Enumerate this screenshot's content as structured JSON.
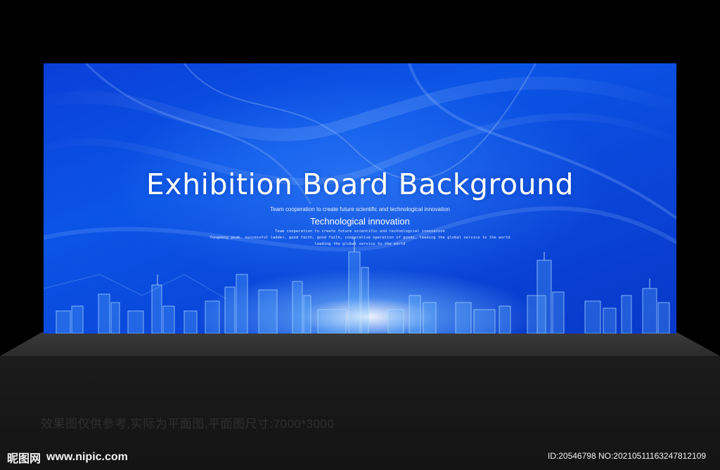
{
  "board": {
    "title": "Exhibition Board Background",
    "line1": "Team cooperation to create future scientific and technological innovation",
    "line2": "Technological innovation",
    "line3": "Team cooperation to create future scientific and technological innovation",
    "line4": "Yongdeng peak, successful ladder, good faith, good faith, cooperative operation of goods, leading the global service to the world",
    "line5": "leading the global service to the world"
  },
  "caption": "效果图仅供参考,实际为平面图,平面图尺寸:7000*3000",
  "watermark": {
    "logo_text": "昵图网",
    "site": "www.nipic.com",
    "ident": "ID:20546798 NO:20210511163247812109"
  },
  "colors": {
    "background": "#000000",
    "board_blue": "#0b4fe3",
    "text": "#ffffff"
  }
}
